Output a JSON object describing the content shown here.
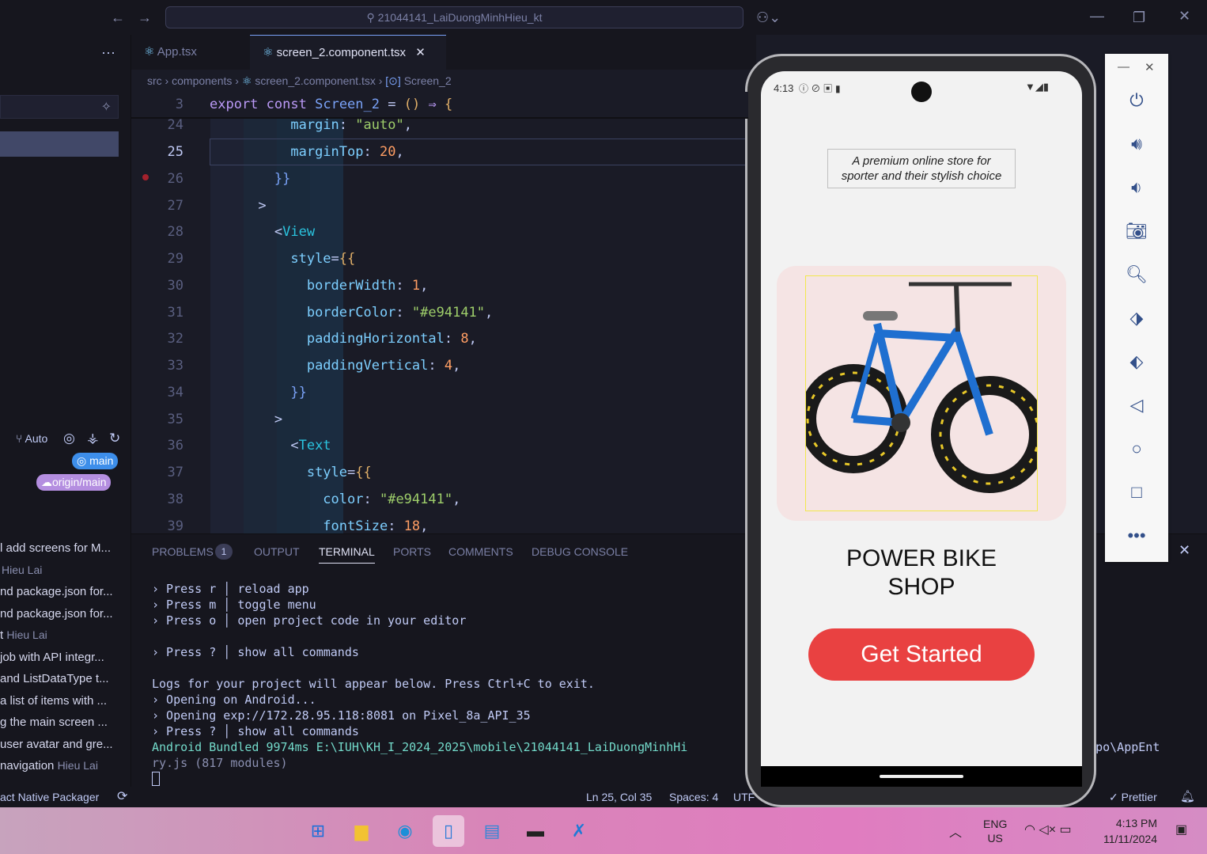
{
  "titlebar": {
    "search_text": "21044141_LaiDuongMinhHieu_kt"
  },
  "sidebar": {
    "auto_label": "Auto",
    "branch_badge": "main",
    "remote_badge": "origin/main",
    "commits": [
      {
        "message": "l add screens for M...",
        "author": ""
      },
      {
        "message": "Hieu Lai",
        "author": ""
      },
      {
        "message": "nd package.json for...",
        "author": ""
      },
      {
        "message": "nd package.json for...",
        "author": ""
      },
      {
        "message": "t",
        "author": "Hieu Lai"
      },
      {
        "message": "job with API integr...",
        "author": ""
      },
      {
        "message": "and ListDataType t...",
        "author": ""
      },
      {
        "message": "a list of items with ...",
        "author": ""
      },
      {
        "message": "g the main screen ...",
        "author": ""
      },
      {
        "message": "user avatar and gre...",
        "author": ""
      },
      {
        "message": "navigation",
        "author": "Hieu Lai"
      }
    ]
  },
  "editor": {
    "tabs": [
      {
        "label": "App.tsx"
      },
      {
        "label": "screen_2.component.tsx"
      }
    ],
    "breadcrumb": {
      "src": "src",
      "components": "components",
      "file": "screen_2.component.tsx",
      "symbol": "Screen_2"
    },
    "sticky_line_number": "3",
    "line_numbers": [
      "24",
      "25",
      "26",
      "27",
      "28",
      "29",
      "30",
      "31",
      "32",
      "33",
      "34",
      "35",
      "36",
      "37",
      "38",
      "39"
    ]
  },
  "panel": {
    "tabs": [
      "PROBLEMS",
      "OUTPUT",
      "TERMINAL",
      "PORTS",
      "COMMENTS",
      "DEBUG CONSOLE"
    ],
    "problems_count": "1",
    "terminal_lines": [
      "› Press r │ reload app",
      "› Press m │ toggle menu",
      "› Press o │ open project code in your editor",
      "",
      "› Press ? │ show all commands",
      "",
      "Logs for your project will appear below. Press Ctrl+C to exit.",
      "› Opening on Android...",
      "› Opening exp://172.28.95.118:8081 on Pixel_8a_API_35",
      "› Press ? │ show all commands",
      "Android Bundled 9974ms E:\\IUH\\KH_I_2024_2025\\mobile\\21044141_LaiDuongMinhHi",
      "ry.js (817 modules)"
    ],
    "terminal_tail": ".expo\\AppEnt"
  },
  "statusbar": {
    "packager": "act Native Packager",
    "position": "Ln 25, Col 35",
    "spaces": "Spaces: 4",
    "encoding": "UTF",
    "prettier": "✓ Prettier"
  },
  "phone": {
    "status_time": "4:13",
    "tagline_line1": "A premium online store for",
    "tagline_line2": "sporter and their stylish choice",
    "title_line1": "POWER BIKE",
    "title_line2": "SHOP",
    "cta_label": "Get Started",
    "accent": "#e94141"
  },
  "taskbar": {
    "lang1": "ENG",
    "lang2": "US",
    "time": "4:13 PM",
    "date": "11/11/2024"
  }
}
